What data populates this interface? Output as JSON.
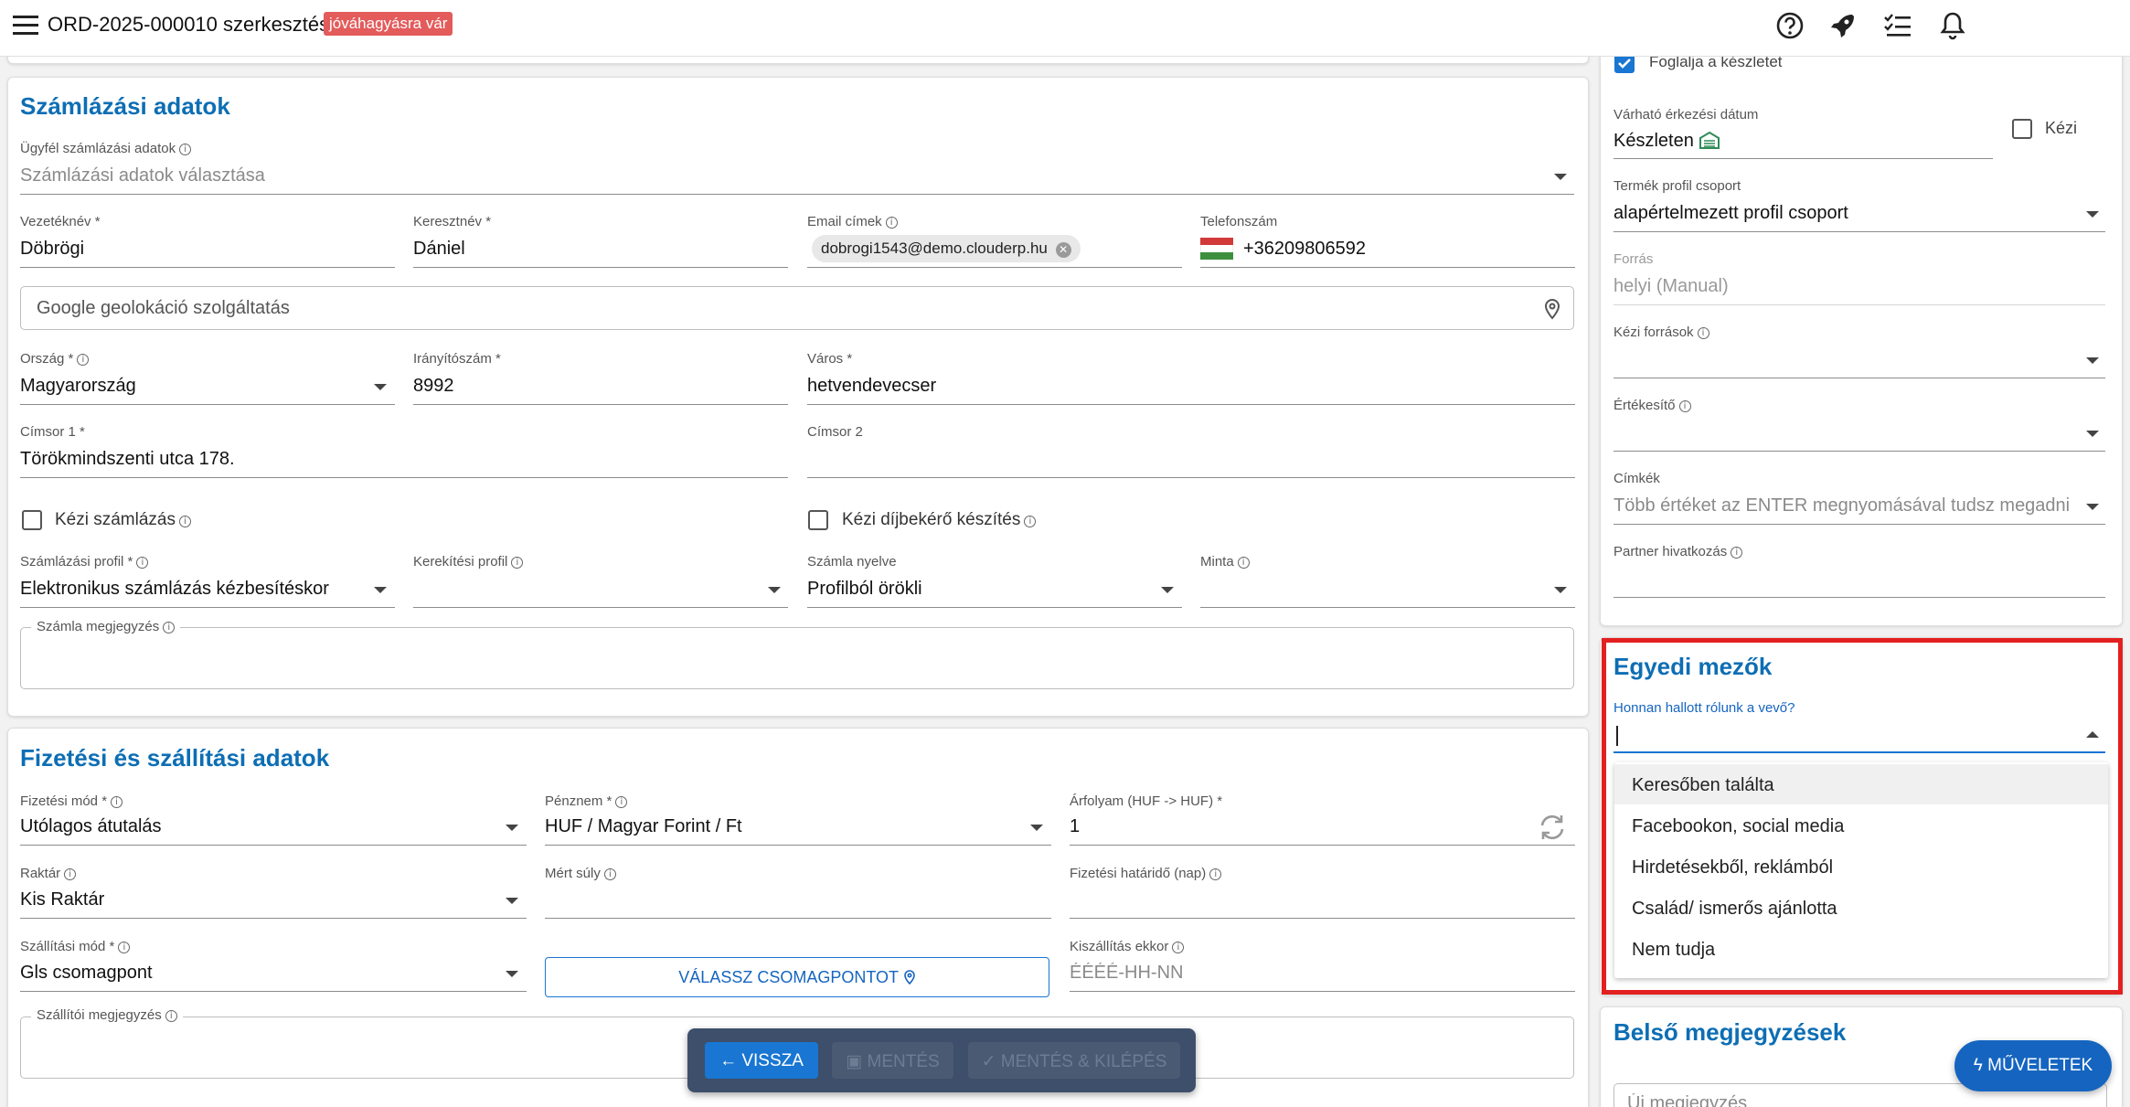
{
  "header": {
    "title": "ORD-2025-000010 szerkesztése",
    "status_badge": "jóváhagyásra vár"
  },
  "billing": {
    "title": "Számlázási adatok",
    "customer_billing_label": "Ügyfél számlázási adatok",
    "customer_billing_placeholder": "Számlázási adatok választása",
    "last_name_label": "Vezetéknév *",
    "last_name_value": "Döbrögi",
    "first_name_label": "Keresztnév *",
    "first_name_value": "Dániel",
    "email_label": "Email címek",
    "email_chip": "dobrogi1543@demo.clouderp.hu",
    "phone_label": "Telefonszám",
    "phone_value": "+36209806592",
    "geo_placeholder": "Google geolokáció szolgáltatás",
    "country_label": "Ország *",
    "country_value": "Magyarország",
    "zip_label": "Irányítószám *",
    "zip_value": "8992",
    "city_label": "Város *",
    "city_value": "hetvendevecser",
    "address1_label": "Címsor 1 *",
    "address1_value": "Törökmindszenti utca 178.",
    "address2_label": "Címsor 2",
    "address2_value": "",
    "manual_billing_label": "Kézi számlázás",
    "manual_proforma_label": "Kézi díjbekérő készítés",
    "billing_profile_label": "Számlázási profil *",
    "billing_profile_value": "Elektronikus számlázás kézbesítéskor",
    "rounding_profile_label": "Kerekítési profil",
    "rounding_profile_value": "",
    "invoice_language_label": "Számla nyelve",
    "invoice_language_value": "Profilból örökli",
    "template_label": "Minta",
    "template_value": "",
    "invoice_note_label": "Számla megjegyzés"
  },
  "payment": {
    "title": "Fizetési és szállítási adatok",
    "method_label": "Fizetési mód *",
    "method_value": "Utólagos átutalás",
    "currency_label": "Pénznem *",
    "currency_value": "HUF / Magyar Forint / Ft",
    "rate_label": "Árfolyam (HUF -> HUF) *",
    "rate_value": "1",
    "warehouse_label": "Raktár",
    "warehouse_value": "Kis Raktár",
    "weight_label": "Mért súly",
    "weight_value": "",
    "deadline_label": "Fizetési határidő (nap)",
    "deadline_value": "",
    "shipping_method_label": "Szállítási mód *",
    "shipping_method_value": "Gls csomagpont",
    "pickup_button": "VÁLASSZ CSOMAGPONTOT",
    "delivery_label": "Kiszállítás ekkor",
    "delivery_placeholder": "ÉÉÉÉ-HH-NN",
    "shipping_note_label": "Szállítói megjegyzés"
  },
  "side": {
    "reserve_label": "Foglalja a készletet",
    "arrival_label": "Várható érkezési dátum",
    "arrival_value": "Készleten",
    "manual_label": "Kézi",
    "product_profile_label": "Termék profil csoport",
    "product_profile_value": "alapértelmezett profil csoport",
    "source_label": "Forrás",
    "source_value": "helyi (Manual)",
    "manual_sources_label": "Kézi források",
    "seller_label": "Értékesítő",
    "tags_label": "Címkék",
    "tags_placeholder": "Több értéket az ENTER megnyomásával tudsz megadni",
    "partner_ref_label": "Partner hivatkozás"
  },
  "custom_fields": {
    "title": "Egyedi mezők",
    "question_label": "Honnan hallott rólunk a vevő?",
    "options": [
      "Keresőben találta",
      "Facebookon, social media",
      "Hirdetésekből, reklámból",
      "Család/ ismerős ajánlotta",
      "Nem tudja"
    ]
  },
  "internal_notes": {
    "title": "Belső megjegyzések",
    "placeholder": "Új megjegyzés"
  },
  "actions": {
    "back": "VISSZA",
    "save": "MENTÉS",
    "save_exit": "MENTÉS & KILÉPÉS",
    "operations": "MŰVELETEK"
  },
  "colors": {
    "accent": "#0d6eb4",
    "highlight": "#e32020",
    "badge": "#e35b5b"
  }
}
